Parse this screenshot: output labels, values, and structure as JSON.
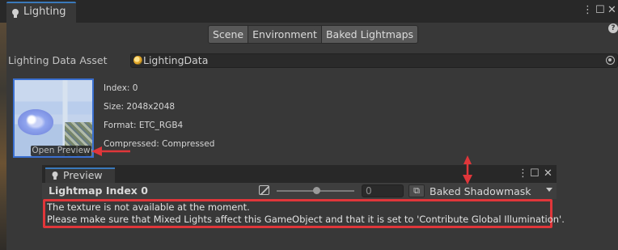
{
  "window": {
    "tab_title": "Lighting",
    "more_glyph": "⋮",
    "maximize_glyph": "☐",
    "close_glyph": "✕",
    "help_glyph": "?"
  },
  "toolbar": {
    "tabs": [
      "Scene",
      "Environment",
      "Baked Lightmaps"
    ],
    "selected": "Environment"
  },
  "lighting_data_asset": {
    "label": "Lighting Data Asset",
    "value": "LightingData"
  },
  "lightmap": {
    "open_preview_label": "Open Preview",
    "index": "Index: 0",
    "size": "Size: 2048x2048",
    "format": "Format: ETC_RGB4",
    "compressed": "Compressed: Compressed"
  },
  "preview": {
    "tab_title": "Preview",
    "title": "Lightmap Index 0",
    "value": "0",
    "layers_glyph": "⧉",
    "dropdown_value": "Baked Shadowmask",
    "message_line1": "The texture is not available at the moment.",
    "message_line2": "Please make sure that Mixed Lights affect this GameObject and that it is set to 'Contribute Global Illumination'.",
    "more_glyph": "⋮",
    "maximize_glyph": "☐",
    "close_glyph": "✕"
  },
  "colors": {
    "panel_bg": "#383838",
    "tab_accent": "#3a79bb",
    "annotation_red": "#e0363a"
  }
}
